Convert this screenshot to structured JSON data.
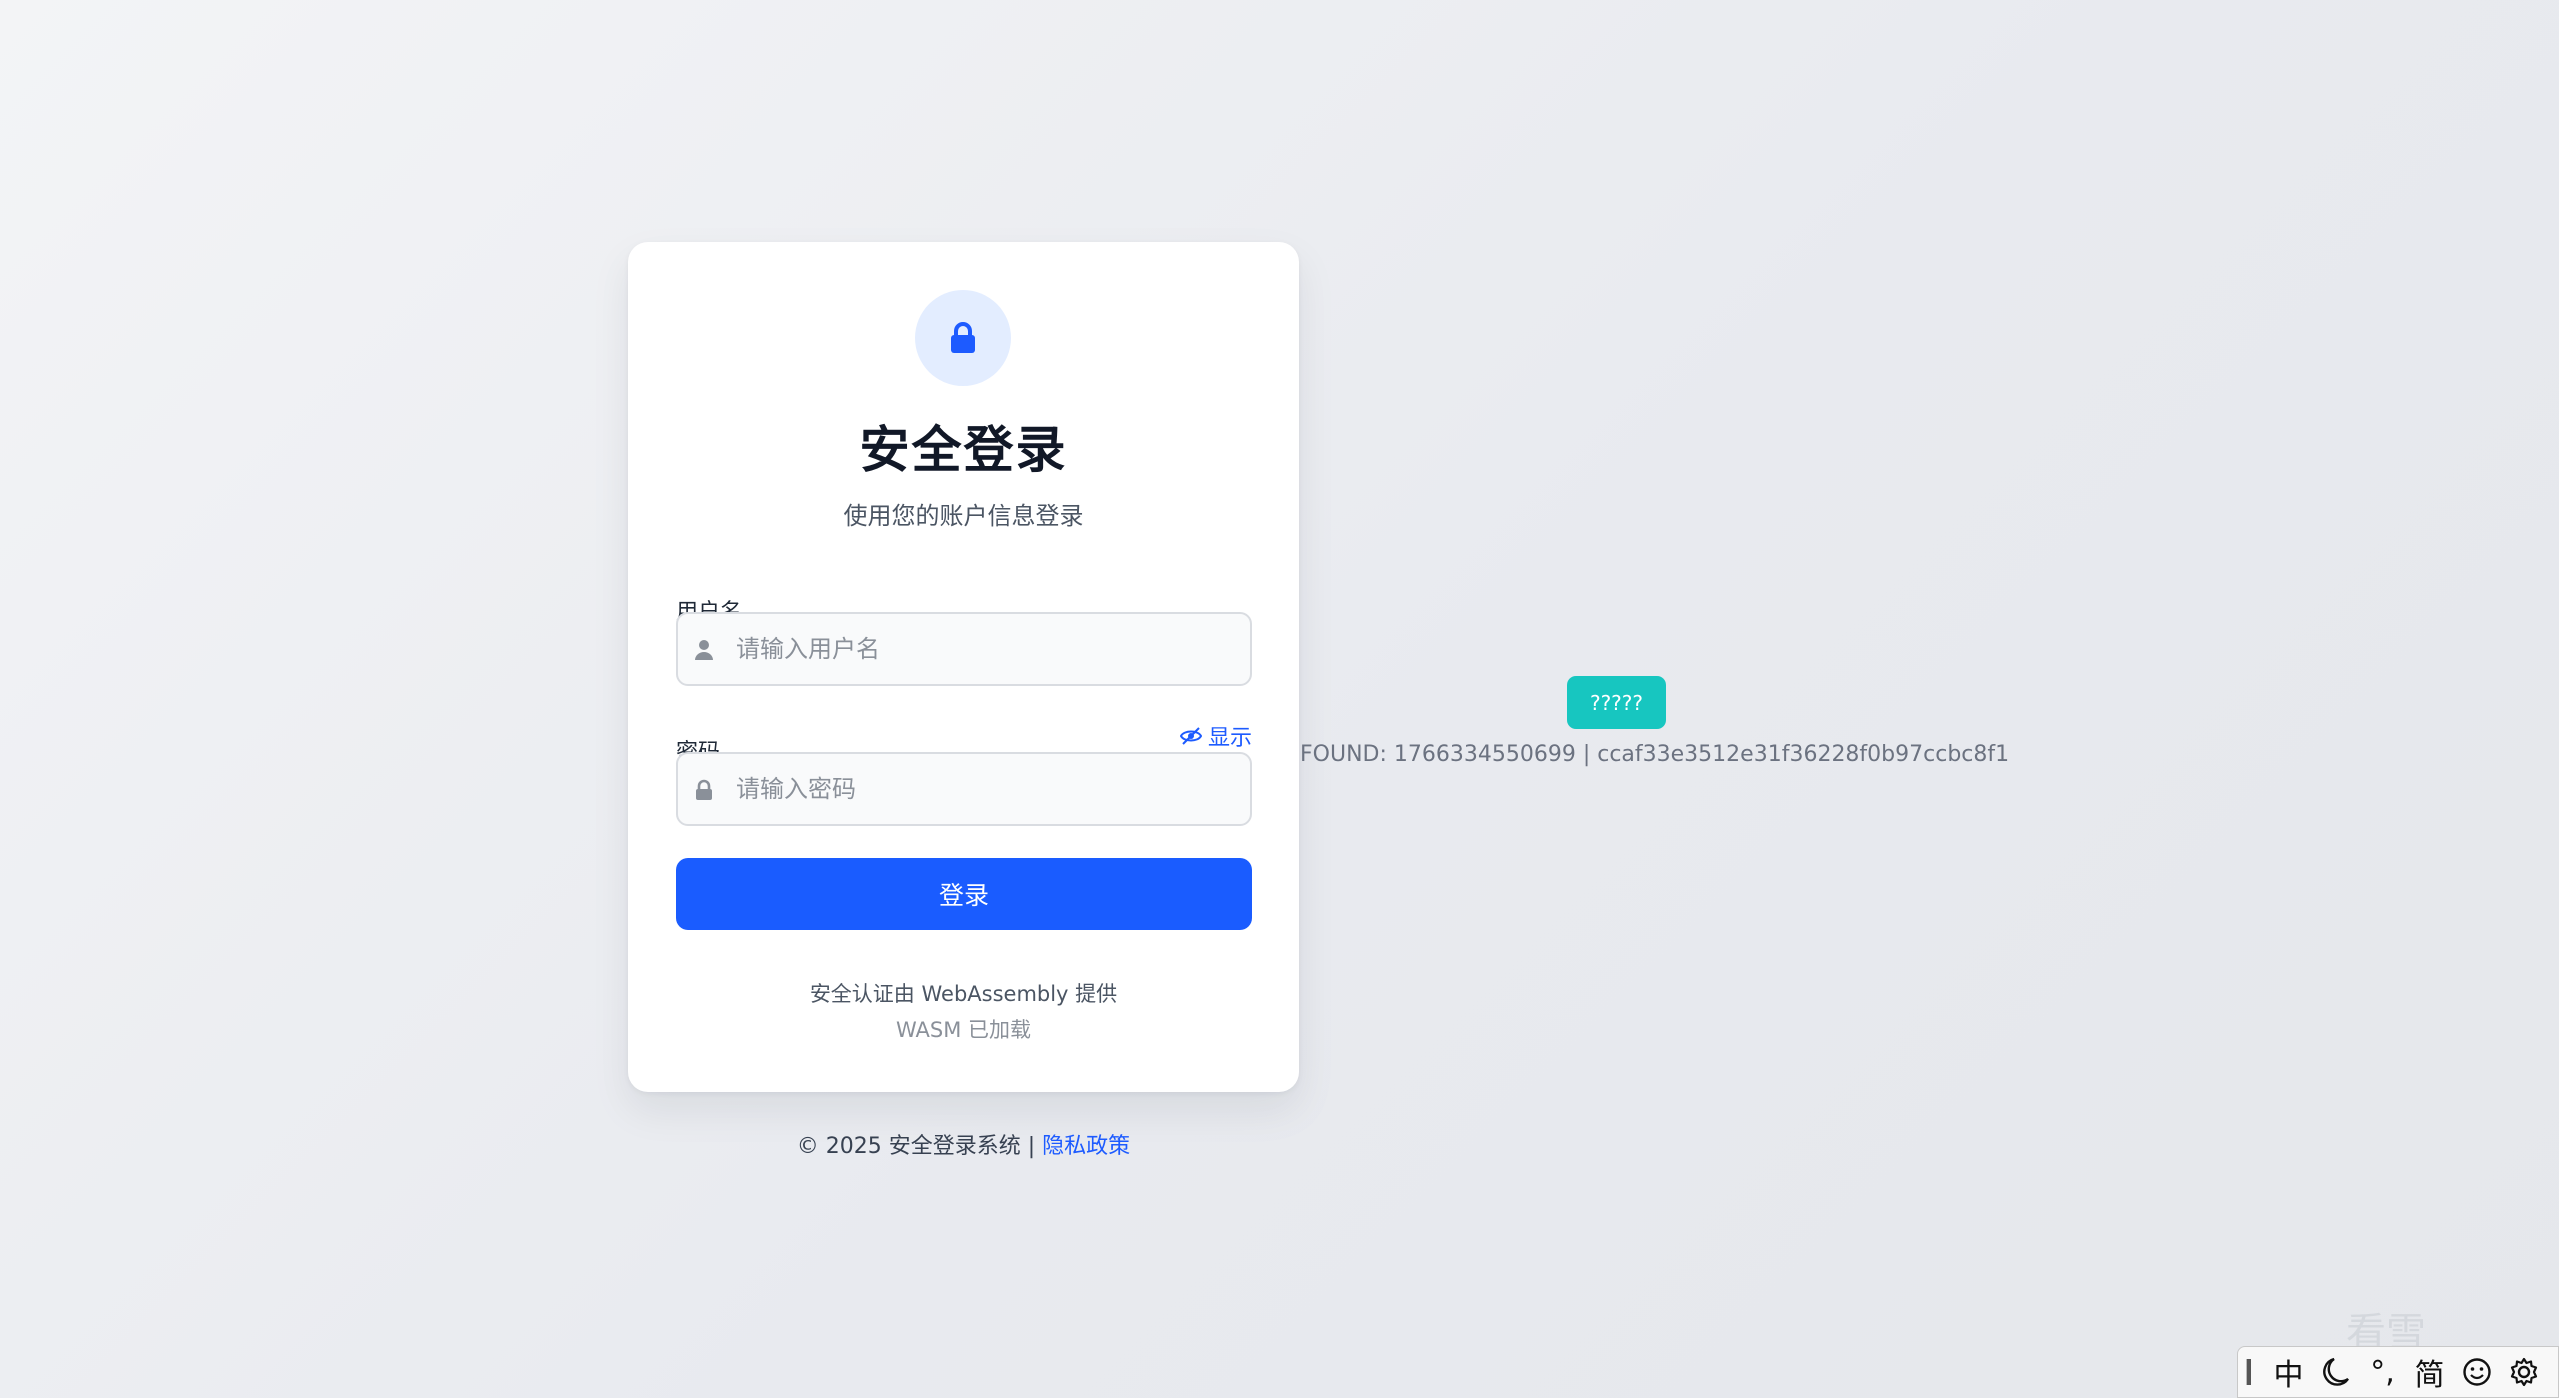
{
  "login": {
    "title": "安全登录",
    "subtitle": "使用您的账户信息登录",
    "username_label": "用户名",
    "username_placeholder": "请输入用户名",
    "password_label": "密码",
    "password_placeholder": "请输入密码",
    "show_password": "显示",
    "submit": "登录",
    "security_note": "安全认证由 WebAssembly 提供",
    "wasm_status": "WASM 已加载"
  },
  "footer": {
    "copyright": "© 2025 安全登录系统 | ",
    "privacy_link": "隐私政策"
  },
  "debug": {
    "button_label": "?????",
    "found_text": "FOUND: 1766334550699 | ccaf33e3512e31f36228f0b97ccbc8f1"
  },
  "watermark": {
    "text": "看雪"
  },
  "ime_toolbar": {
    "mode": "中",
    "punctuation": "°,",
    "script": "简"
  },
  "icons": {
    "lock": "lock-icon",
    "user": "user-icon",
    "eye": "eye-slash-icon",
    "moon": "moon-icon",
    "emoji": "smiley-icon",
    "settings": "gear-icon"
  },
  "colors": {
    "primary": "#1a5cff",
    "link": "#1d5bff",
    "teal": "#17c6c0",
    "lock_bg": "#e3edff"
  }
}
